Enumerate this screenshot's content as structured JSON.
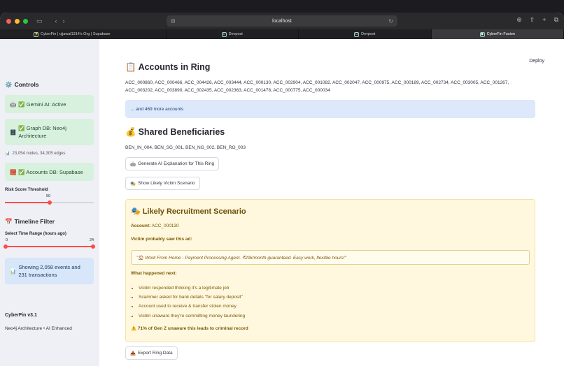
{
  "browser": {
    "url": "localhost",
    "tabs": [
      {
        "label": "CyberFin | ujjawal1314's Org | Supabase",
        "active": false
      },
      {
        "label": "Devpost",
        "active": false
      },
      {
        "label": "Devpost",
        "active": false
      },
      {
        "label": "CyberFin Fusion",
        "active": true
      }
    ]
  },
  "sidebar": {
    "controls_title": "Controls",
    "gemini_status": "✅ Gemini AI: Active",
    "graph_status": "✅ Graph DB: Neo4j Architecture",
    "graph_stats": "23,054 nodes, 34,305 edges",
    "accounts_status": "✅ Accounts DB: Supabase",
    "risk_label": "Risk Score Threshold",
    "risk_value": "50",
    "risk_fraction": 0.5,
    "timeline_title": "Timeline Filter",
    "time_label": "Select Time Range (hours ago)",
    "time_min": "0",
    "time_max": "24",
    "events_summary": "Showing 2,058 events and 231 transactions",
    "version": "CyberFin v3.1",
    "tagline": "Neo4j Architecture • AI Enhanced"
  },
  "main": {
    "deploy_label": "Deploy",
    "accounts_title": "Accounts in Ring",
    "accounts_line1": "ACC_000860, ACC_000466, ACC_004426, ACC_003444, ACC_000130, ACC_002904, ACC_001082, ACC_002047, ACC_000975, ACC_000189, ACC_002734, ACC_003005, ACC_001267,",
    "accounts_line2": "ACC_003202, ACC_003890, ACC_002435, ACC_002363, ACC_001478, ACC_000775, ACC_000034",
    "more_accounts": "... and 469 more accounts",
    "beneficiaries_title": "Shared Beneficiaries",
    "beneficiaries": "BEN_IN_004, BEN_SG_001, BEN_NG_002, BEN_RO_003",
    "ai_button": "Generate AI Explanation for This Ring",
    "victim_button": "Show Likely Victim Scenario",
    "scenario": {
      "title": "Likely Recruitment Scenario",
      "account_label": "Account:",
      "account_value": "ACC_000130",
      "ad_label": "Victim probably saw this ad:",
      "ad_text": "\"🏠 Work From Home - Payment Processing Agent. ₹20k/month guaranteed. Easy work, flexible hours!\"",
      "next_label": "What happened next:",
      "steps": [
        "Victim responded thinking it's a legitimate job",
        "Scammer asked for bank details \"for salary deposit\"",
        "Account used to receive & transfer stolen money",
        "Victim unaware they're committing money laundering"
      ],
      "warning": "⚠️ 71% of Gen Z unaware this leads to criminal record"
    },
    "export_button": "Export Ring Data"
  }
}
